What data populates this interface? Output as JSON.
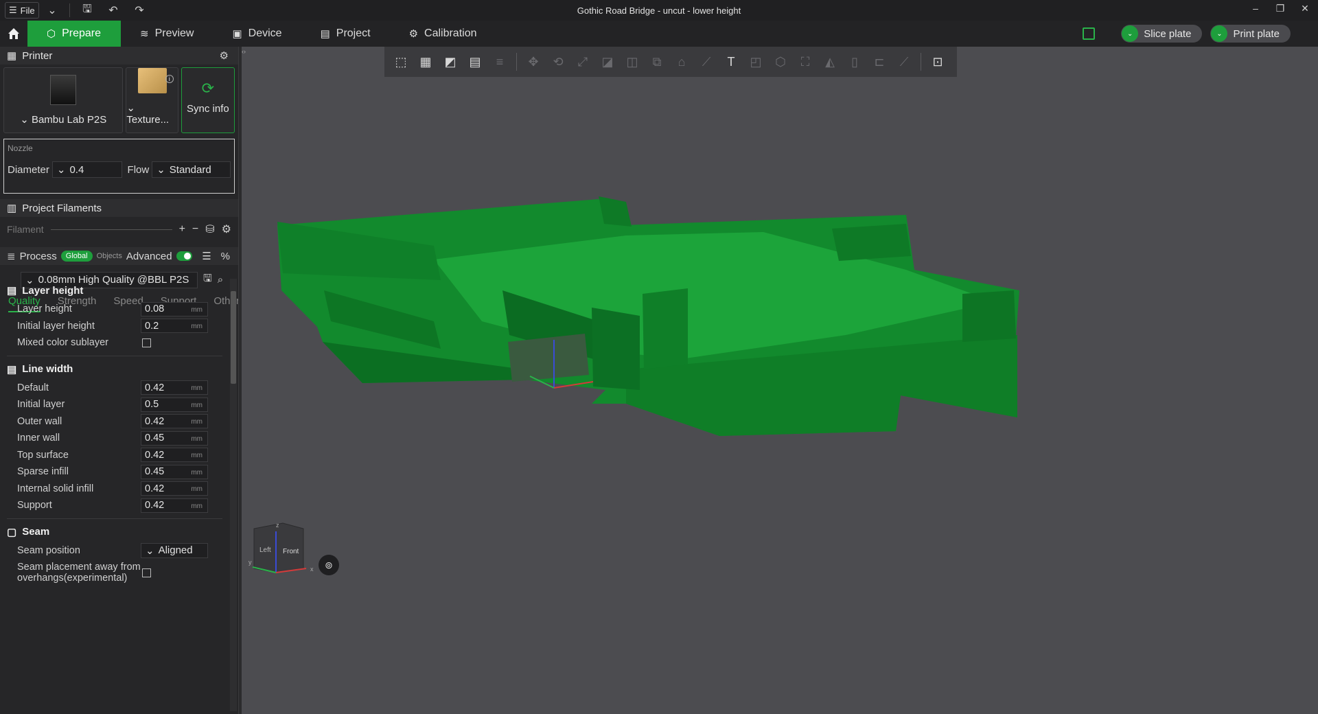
{
  "titlebar": {
    "file_label": "File",
    "window_title": "Gothic Road Bridge - uncut - lower height"
  },
  "tabs": [
    {
      "label": "Prepare",
      "active": true
    },
    {
      "label": "Preview"
    },
    {
      "label": "Device"
    },
    {
      "label": "Project"
    },
    {
      "label": "Calibration"
    }
  ],
  "actions": {
    "slice_label": "Slice plate",
    "print_label": "Print plate"
  },
  "printer": {
    "section_title": "Printer",
    "printer_name": "Bambu Lab P2S",
    "plate_name": "Texture...",
    "sync_label": "Sync info"
  },
  "nozzle": {
    "title": "Nozzle",
    "diameter_label": "Diameter",
    "diameter_value": "0.4",
    "flow_label": "Flow",
    "flow_value": "Standard"
  },
  "filaments": {
    "section_title": "Project Filaments",
    "placeholder": "Filament"
  },
  "process": {
    "title": "Process",
    "global_label": "Global",
    "objects_label": "Objects",
    "advanced_label": "Advanced",
    "preset": "0.08mm High Quality @BBL P2S",
    "tabs": [
      "Quality",
      "Strength",
      "Speed",
      "Support",
      "Others"
    ]
  },
  "layer_height": {
    "title": "Layer height",
    "layer_height_label": "Layer height",
    "layer_height_value": "0.08",
    "initial_label": "Initial layer height",
    "initial_value": "0.2",
    "mixed_label": "Mixed color sublayer"
  },
  "line_width": {
    "title": "Line width",
    "rows": [
      {
        "label": "Default",
        "value": "0.42"
      },
      {
        "label": "Initial layer",
        "value": "0.5"
      },
      {
        "label": "Outer wall",
        "value": "0.42"
      },
      {
        "label": "Inner wall",
        "value": "0.45"
      },
      {
        "label": "Top surface",
        "value": "0.42"
      },
      {
        "label": "Sparse infill",
        "value": "0.45"
      },
      {
        "label": "Internal solid infill",
        "value": "0.42"
      },
      {
        "label": "Support",
        "value": "0.42"
      }
    ]
  },
  "seam": {
    "title": "Seam",
    "position_label": "Seam position",
    "position_value": "Aligned",
    "placement_label_1": "Seam placement away from",
    "placement_label_2": "overhangs(experimental)"
  },
  "unit": "mm",
  "viewcube": {
    "left_label": "Left",
    "front_label": "Front",
    "axis_x": "x",
    "axis_y": "y",
    "axis_z": "z"
  },
  "colors": {
    "accent": "#1e9e3c",
    "model": "#118a2c"
  }
}
